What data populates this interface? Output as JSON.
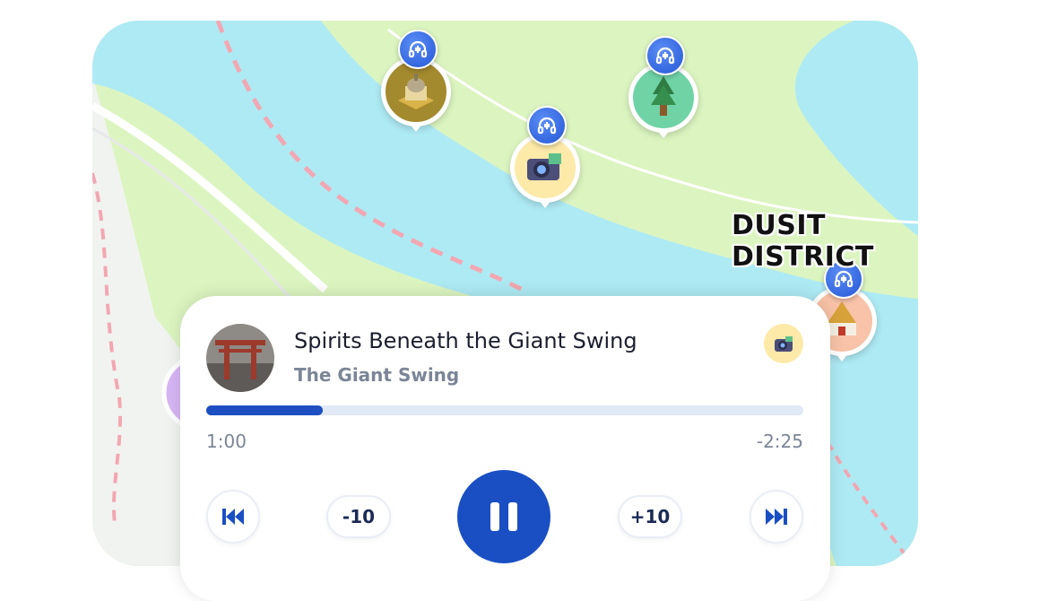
{
  "map": {
    "district_label": "DUSIT DISTRICT",
    "colors": {
      "land": "#dcf5c0",
      "water": "#aeeaf4",
      "road": "#ffffff",
      "boundary": "#f2a7b2"
    },
    "pins": [
      {
        "name": "palace",
        "icon": "palace-icon",
        "badge_icon": "headphones-icon",
        "color": "#a48a2e"
      },
      {
        "name": "camera",
        "icon": "camera-icon",
        "badge_icon": "headphones-icon",
        "color": "#fde9a8"
      },
      {
        "name": "tree",
        "icon": "tree-icon",
        "badge_icon": "headphones-icon",
        "color": "#6fd3a6"
      },
      {
        "name": "temple",
        "icon": "temple-icon",
        "badge_icon": "headphones-icon",
        "color": "#f8c3a8"
      }
    ]
  },
  "player": {
    "title": "Spirits Beneath the Giant Swing",
    "subtitle": "The Giant Swing",
    "category_icon": "camera-icon",
    "thumbnail_icon": "torii-gate-icon",
    "progress": 0.195,
    "elapsed": "1:00",
    "remaining": "-2:25",
    "controls": {
      "previous_icon": "skip-back-icon",
      "rewind_label": "-10",
      "pause_icon": "pause-icon",
      "forward_label": "+10",
      "next_icon": "skip-forward-icon"
    },
    "accent": "#1a4fc4"
  }
}
